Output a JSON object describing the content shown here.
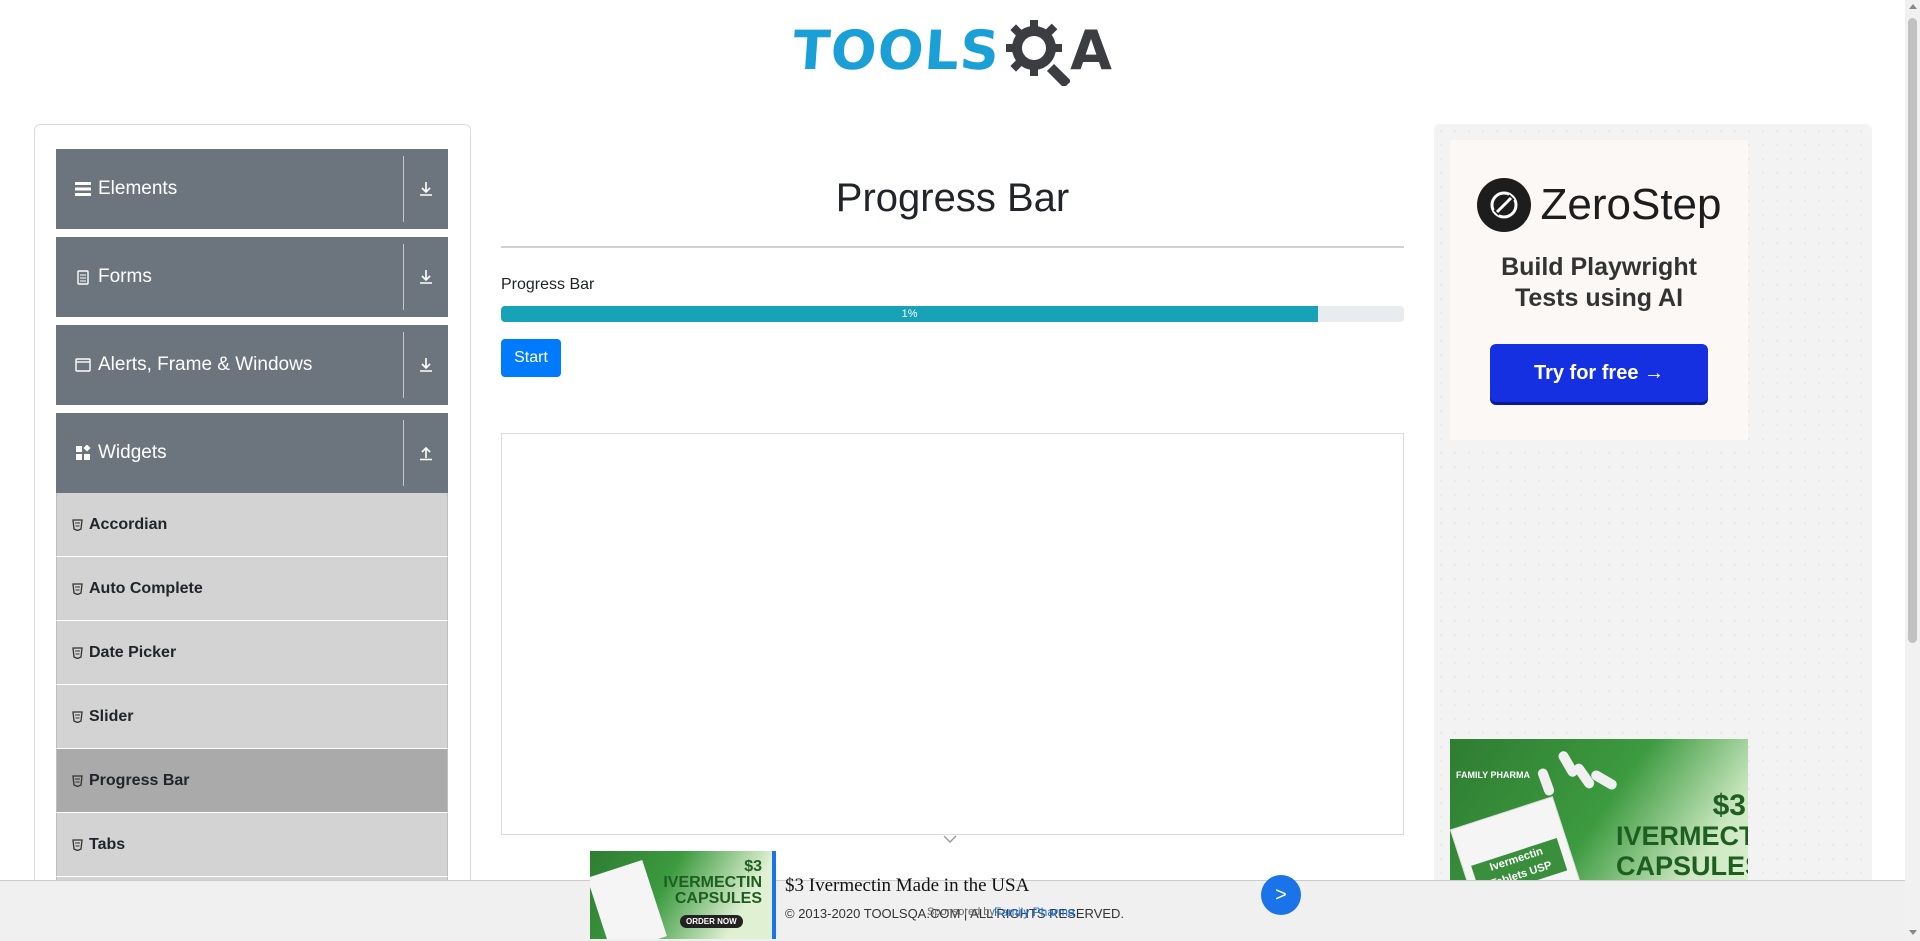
{
  "header": {
    "logo_tools": "TOOLS",
    "logo_qa": "A"
  },
  "sidebar": {
    "groups": [
      {
        "label": "Elements",
        "icon": "hamburger-icon",
        "expanded": false
      },
      {
        "label": "Forms",
        "icon": "form-icon",
        "expanded": false
      },
      {
        "label": "Alerts, Frame & Windows",
        "icon": "window-icon",
        "expanded": false
      },
      {
        "label": "Widgets",
        "icon": "widgets-icon",
        "expanded": true
      }
    ],
    "items": [
      {
        "label": "Accordian",
        "active": false
      },
      {
        "label": "Auto Complete",
        "active": false
      },
      {
        "label": "Date Picker",
        "active": false
      },
      {
        "label": "Slider",
        "active": false
      },
      {
        "label": "Progress Bar",
        "active": true
      },
      {
        "label": "Tabs",
        "active": false
      }
    ]
  },
  "main": {
    "title": "Progress Bar",
    "progress_label": "Progress Bar",
    "progress_value": 1,
    "progress_text": "1%",
    "progress_bar_fill_fraction": 0.905,
    "start_label": "Start"
  },
  "right_ads": {
    "zerostep": {
      "brand": "ZeroStep",
      "tagline": "Build Playwright Tests using AI",
      "cta": "Try for free →"
    },
    "ivermectin": {
      "badge": "FAMILY PHARMA",
      "box_label": "Ivermectin Tablets USP",
      "price": "$3",
      "word1": "IVERMECTIN",
      "word2": "CAPSULES"
    }
  },
  "bottom_ad": {
    "price": "$3",
    "line1": "IVERMECTIN",
    "line2": "CAPSULES",
    "order": "ORDER NOW",
    "headline": "$3 Ivermectin Made in the USA",
    "go": ">"
  },
  "footer": {
    "copyright": "© 2013-2020 TOOLSQA.COM | ALL RIGHTS RESERVED.",
    "sponsored": "Sponsored by",
    "sponsor": "Family Pharma"
  },
  "colors": {
    "sidebar_group": "#6c757d",
    "sidebar_item": "#d3d3d3",
    "sidebar_active": "#aaaaaa",
    "progress_fill": "#17a2b8",
    "primary": "#007bff",
    "logo_blue": "#1aa0d6",
    "logo_dark": "#3b3d40"
  }
}
